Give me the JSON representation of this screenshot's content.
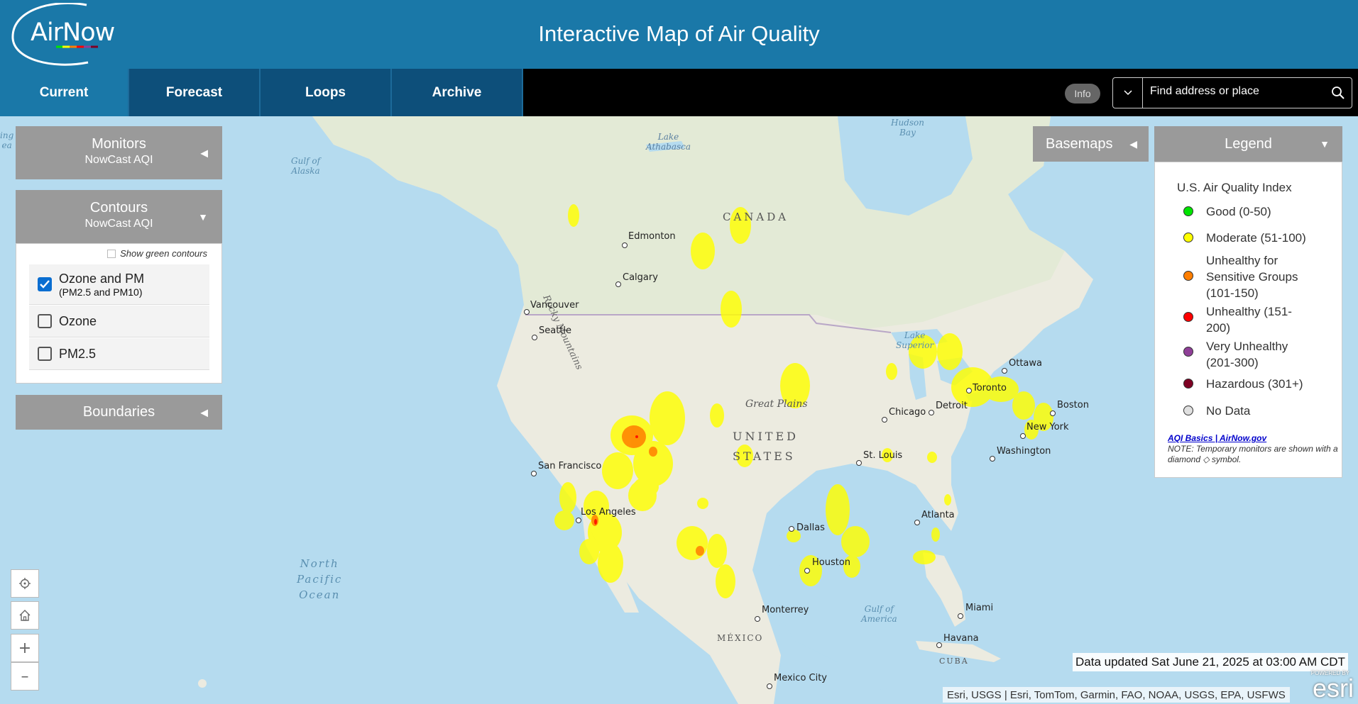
{
  "header": {
    "logo_text": "AirNow",
    "title": "Interactive Map of Air Quality"
  },
  "nav": {
    "tabs": [
      {
        "label": "Current",
        "active": true
      },
      {
        "label": "Forecast",
        "active": false
      },
      {
        "label": "Loops",
        "active": false
      },
      {
        "label": "Archive",
        "active": false
      }
    ],
    "info_label": "Info",
    "search_placeholder": "Find address or place"
  },
  "panels": {
    "monitors": {
      "title": "Monitors",
      "subtitle": "NowCast AQI"
    },
    "contours": {
      "title": "Contours",
      "subtitle": "NowCast AQI",
      "green_option": "Show green contours",
      "options": [
        {
          "label": "Ozone and PM",
          "sub": "(PM2.5 and PM10)",
          "checked": true
        },
        {
          "label": "Ozone",
          "sub": "",
          "checked": false
        },
        {
          "label": "PM2.5",
          "sub": "",
          "checked": false
        }
      ]
    },
    "boundaries": {
      "title": "Boundaries"
    }
  },
  "basemaps_label": "Basemaps",
  "legend": {
    "header": "Legend",
    "title": "U.S. Air Quality Index",
    "items": [
      {
        "label": "Good (0-50)",
        "color": "#00e400"
      },
      {
        "label": "Moderate (51-100)",
        "color": "#ffff00"
      },
      {
        "label": "Unhealthy for Sensitive Groups (101-150)",
        "color": "#ff7e00"
      },
      {
        "label": "Unhealthy (151-200)",
        "color": "#ff0000"
      },
      {
        "label": "Very Unhealthy (201-300)",
        "color": "#8f3f97"
      },
      {
        "label": "Hazardous (301+)",
        "color": "#7e0023"
      },
      {
        "label": "No Data",
        "color": "#e0e0e0"
      }
    ],
    "link": "AQI Basics | AirNow.gov",
    "note": "NOTE: Temporary monitors are shown with a diamond ◇ symbol."
  },
  "map": {
    "cities": [
      "Edmonton",
      "Calgary",
      "Vancouver",
      "Seattle",
      "San Francisco",
      "Los Angeles",
      "Dallas",
      "Houston",
      "Chicago",
      "Detroit",
      "St. Louis",
      "Atlanta",
      "Washington",
      "New York",
      "Boston",
      "Ottawa",
      "Toronto",
      "Monterrey",
      "Mexico City",
      "Miami",
      "Havana"
    ],
    "countries": [
      "CANADA",
      "UNITED",
      "STATES",
      "MÉXICO",
      "CUBA"
    ],
    "water": [
      "Gulf of Alaska",
      "North Pacific Ocean",
      "Hudson Bay",
      "Lake Athabasca",
      "Gulf of America",
      "Lake Superior"
    ],
    "regions": [
      "Great Plains",
      "Rocky Mountains"
    ]
  },
  "status": {
    "updated": "Data updated Sat June 21, 2025 at 03:00 AM CDT",
    "attribution": "Esri, USGS | Esri, TomTom, Garmin, FAO, NOAA, USGS, EPA, USFWS",
    "esri_powered": "POWERED BY",
    "esri_name": "esri"
  },
  "colors": {
    "header": "#1a78a8",
    "nav_tab": "#0d4f7a",
    "moderate": "#ffff00",
    "usg": "#ff7e00",
    "unhealthy": "#ff0000"
  }
}
